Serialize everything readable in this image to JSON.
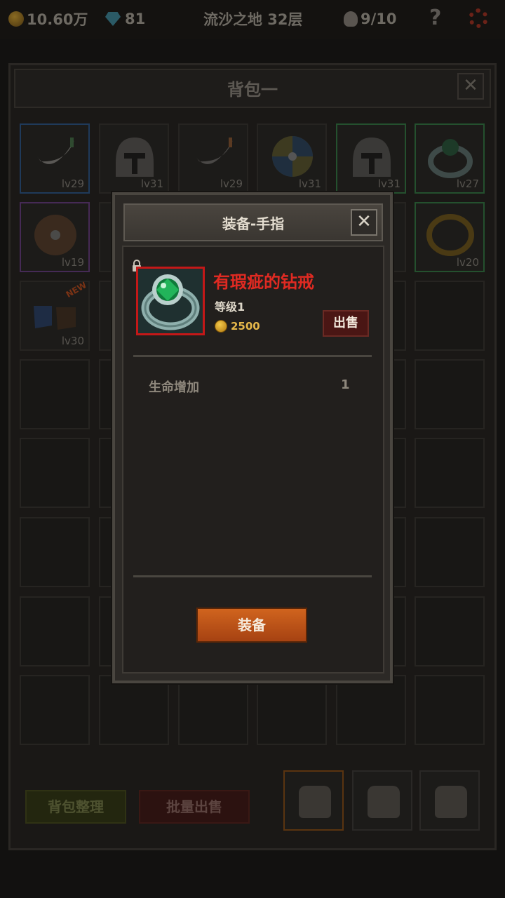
{
  "topbar": {
    "gold": "10.60万",
    "gems": "81",
    "stage": "流沙之地 32层",
    "kills": "9/10",
    "help": "?"
  },
  "bag": {
    "title": "背包一",
    "close": "✕",
    "sort_label": "背包整理",
    "batch_sell_label": "批量出售",
    "slots": [
      {
        "lv": "lv29",
        "rarity": "blue",
        "icon": "scythe-icon"
      },
      {
        "lv": "lv31",
        "rarity": "none",
        "icon": "helmet-icon"
      },
      {
        "lv": "lv29",
        "rarity": "none",
        "icon": "scythe-icon"
      },
      {
        "lv": "lv31",
        "rarity": "none",
        "icon": "shield-icon"
      },
      {
        "lv": "lv31",
        "rarity": "green",
        "icon": "helmet-icon"
      },
      {
        "lv": "lv27",
        "rarity": "green",
        "icon": "ring-icon"
      },
      {
        "lv": "lv19",
        "rarity": "purple",
        "icon": "wooden-shield-icon"
      },
      {
        "lv": "lv20",
        "rarity": "green",
        "icon": "gold-ring-icon"
      },
      {
        "lv": "lv30",
        "rarity": "none",
        "icon": "boots-icon",
        "new": "NEW"
      }
    ]
  },
  "modal": {
    "title": "装备-手指",
    "close": "✕",
    "item_name": "有瑕疵的钻戒",
    "item_level": "等级1",
    "price": "2500",
    "sell_label": "出售",
    "stat_label": "生命增加",
    "stat_value": "1",
    "equip_label": "装备"
  },
  "colors": {
    "item_name": "#e02a22",
    "price": "#e6b84a",
    "equip_button": "#c05a1a"
  }
}
